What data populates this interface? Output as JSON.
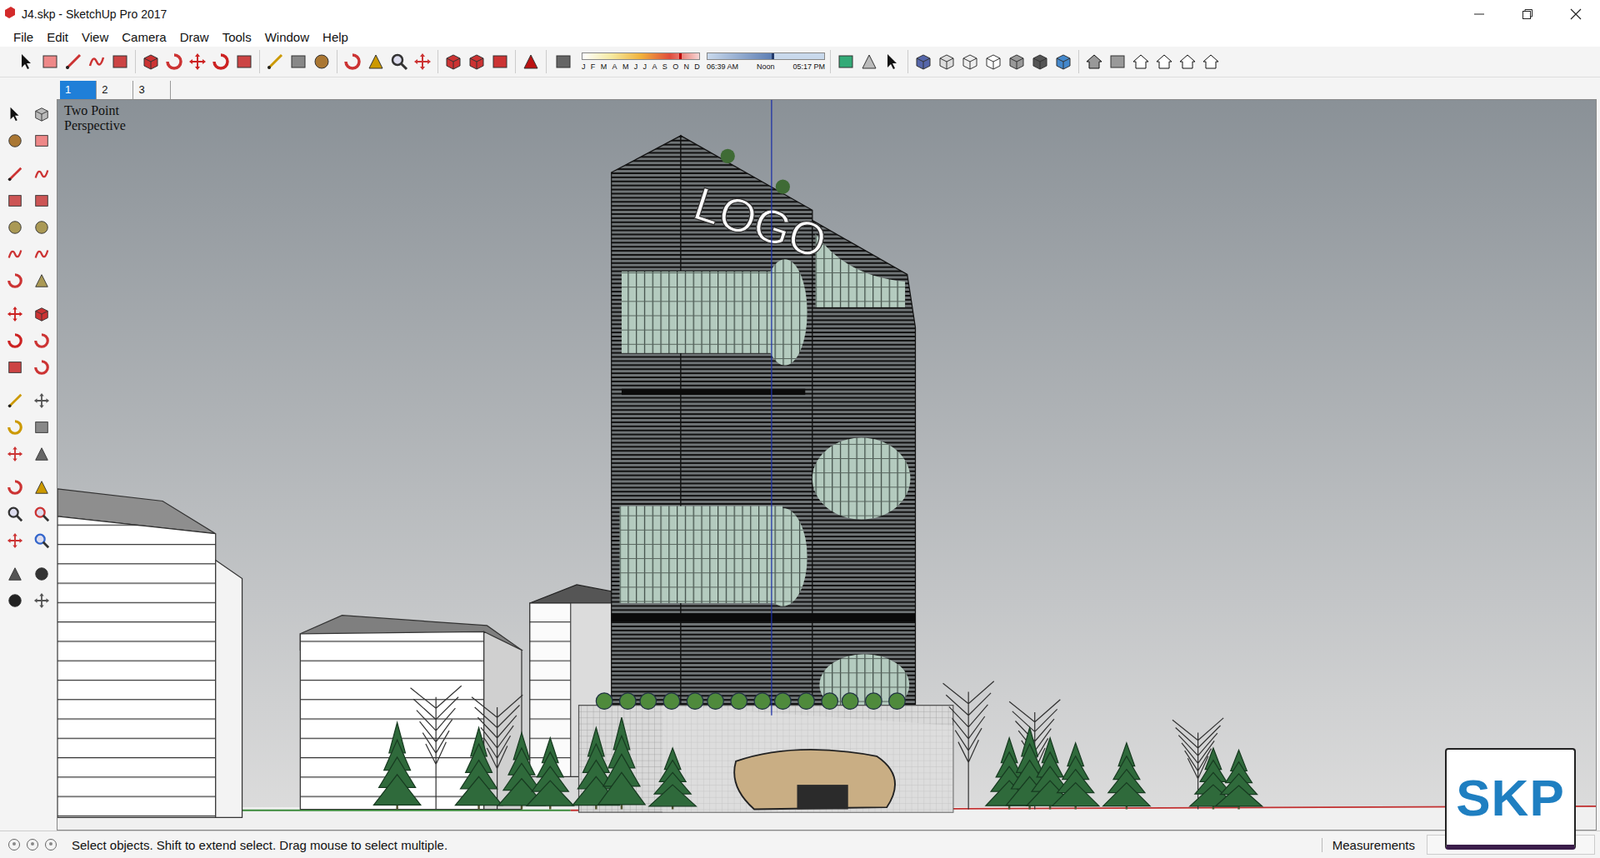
{
  "window": {
    "title": "J4.skp - SketchUp Pro 2017"
  },
  "menu": [
    "File",
    "Edit",
    "View",
    "Camera",
    "Draw",
    "Tools",
    "Window",
    "Help"
  ],
  "shadows": {
    "months": [
      "J",
      "F",
      "M",
      "A",
      "M",
      "J",
      "J",
      "A",
      "S",
      "O",
      "N",
      "D"
    ],
    "month_level": 0.83,
    "time_level": 0.55,
    "time_labels": [
      "06:39 AM",
      "Noon",
      "05:17 PM"
    ]
  },
  "scene_tabs": [
    {
      "label": "1",
      "selected": true
    },
    {
      "label": "2",
      "selected": false
    },
    {
      "label": "3",
      "selected": false
    }
  ],
  "viewport": {
    "camera_label": [
      "Two Point",
      "Perspective"
    ],
    "sign_text": "LOGO"
  },
  "watermark": "SKP",
  "status_bar": {
    "hint": "Select objects. Shift to extend select. Drag mouse to select multiple.",
    "measurements_label": "Measurements"
  }
}
